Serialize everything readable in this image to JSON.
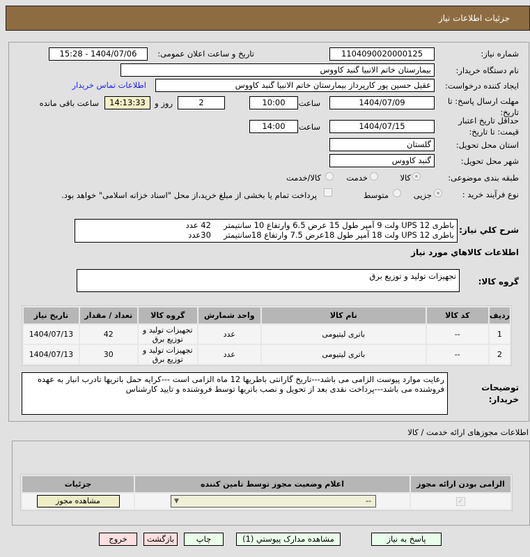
{
  "header": {
    "title": "جزئیات اطلاعات نیاز"
  },
  "form": {
    "need_number_label": "شماره نیاز:",
    "need_number": "1104090020000125",
    "announce_label": "تاریخ و ساعت اعلان عمومی:",
    "announce_value": "1404/07/06 - 15:28",
    "buyer_org_label": "نام دستگاه خریدار:",
    "buyer_org": "بیمارستان خاتم الانبیا گنبد کاووس",
    "creator_label": "ایجاد کننده درخواست:",
    "creator": "عقیل حسین پور کارپرداز بیمارستان خاتم الانبیا گنبد کاووس",
    "contact_link": "اطلاعات تماس خریدار",
    "deadline_label": "مهلت ارسال پاسخ: تا تاریخ:",
    "deadline_date": "1404/07/09",
    "time_label": "ساعت",
    "deadline_time": "10:00",
    "days": "2",
    "days_label": "روز و",
    "remaining": "14:13:33",
    "remaining_label": "ساعت باقی مانده",
    "validity_label": "حداقل تاریخ اعتبار قیمت: تا تاریخ:",
    "validity_date": "1404/07/15",
    "validity_time": "14:00",
    "province_label": "استان محل تحویل:",
    "province": "گلستان",
    "city_label": "شهر محل تحویل:",
    "city": "گنبد کاووس",
    "category_label": "طبقه بندی موضوعی:",
    "category_options": [
      "کالا",
      "خدمت",
      "کالا/خدمت"
    ],
    "process_label": "نوع فرآیند خرید :",
    "process_options": [
      "جزیی",
      "متوسط"
    ],
    "payment_note": "پرداخت تمام یا بخشی از مبلغ خرید،از محل \"اسناد خزانه اسلامی\" خواهد بود."
  },
  "description": {
    "label": "شرح کلي نياز:",
    "line1": "باطری UPS 12 ولت 9 آمپر طول 15 عرض 6.5 وارتفاع 10 سانتیمتر     42 عدد",
    "line2": "باطری UPS 12 ولت 18 آمپر طول 18عرض 7.5 وارتفاع 18سانتیمتر     30عدد"
  },
  "goods": {
    "section_title": "اطلاعات كالاهاي مورد نياز",
    "group_label": "گروه کالا:",
    "group_value": "تجهیزات تولید و توزیع برق",
    "columns": [
      "ردیف",
      "کد کالا",
      "نام کالا",
      "واحد شمارش",
      "گروه کالا",
      "تعداد / مقدار",
      "تاریخ نیاز"
    ],
    "rows": [
      [
        "1",
        "--",
        "باتری لیتیومی",
        "عدد",
        "تجهیزات تولید و توزیع برق",
        "42",
        "1404/07/13"
      ],
      [
        "2",
        "--",
        "باتری لیتیومی",
        "عدد",
        "تجهیزات تولید و توزیع برق",
        "30",
        "1404/07/13"
      ]
    ]
  },
  "notes": {
    "label": "توضیحات خریدار:",
    "text": "رعایت موارد پیوست الزامی می باشد---تاریخ گارانتی باطریها 12 ماه الزامی است ---کرایه حمل باتریها تادرب انبار به عهده فروشنده می باشد---پرداخت نقدی بعد از تحویل و نصب باتریها توسط فروشنده و تایید کارشناس"
  },
  "permits": {
    "title": "اطلاعات مجوزهای ارائه خدمت / کالا",
    "columns": [
      "الزامی بودن ارائه مجوز",
      "اعلام وضعیت مجوز توسط تامین کننده",
      "جزئیات"
    ],
    "select_value": "--",
    "view_button": "مشاهده مجوز"
  },
  "buttons": {
    "reply": "پاسخ به نیاز",
    "attachments": "مشاهده مدارک پیوستي (1)",
    "print": "چاپ",
    "back": "بازگشت",
    "exit": "خروج"
  }
}
